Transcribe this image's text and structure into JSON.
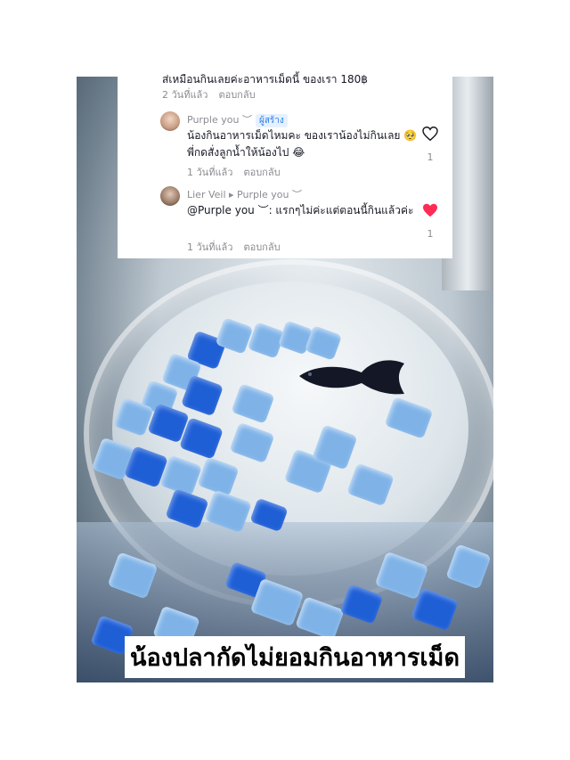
{
  "comments": [
    {
      "text": "ส่เหมือนกินเลยค่ะอาหารเม็ดนี้ ของเรา 180฿",
      "meta": {
        "time": "2 วันที่แล้ว",
        "reply": "ตอบกลับ"
      }
    },
    {
      "author": "Purple you ︶",
      "badge": "ผู้สร้าง",
      "text": "น้องกินอาหารเม็ดไหมคะ ของเราน้องไม่กินเลย 🥺 พี่กดสั่งลูกน้ำให้น้องไป 😂",
      "meta": {
        "time": "1 วันที่แล้ว",
        "reply": "ตอบกลับ"
      },
      "like": {
        "icon": "heart-outline-icon",
        "count": "1"
      }
    },
    {
      "author": "Lier Veil ▸ Purple you ︶",
      "text": "@Purple you ︶: แรกๆไม่ค่ะแต่ตอนนี้กินแล้วค่ะ",
      "meta": {
        "time": "1 วันที่แล้ว",
        "reply": "ตอบกลับ"
      },
      "like": {
        "icon": "heart-filled-icon",
        "count": "1",
        "color": "#fe2c55"
      }
    }
  ],
  "caption": "น้องปลากัดไม่ยอมกินอาหารเม็ด",
  "colors": {
    "creator_badge": "#2b7de9",
    "liked": "#fe2c55"
  }
}
